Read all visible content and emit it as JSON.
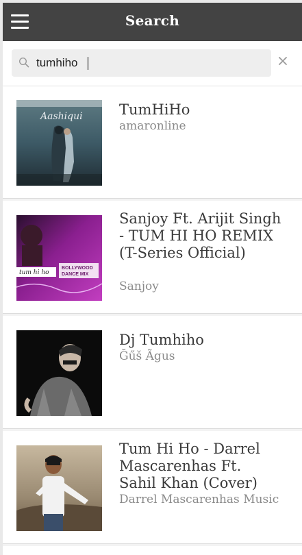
{
  "header": {
    "title": "Search",
    "menu_icon": "hamburger-menu-icon"
  },
  "search": {
    "value": "tumhiho",
    "search_icon": "search-icon",
    "clear_icon": "close-icon"
  },
  "results": [
    {
      "title": "TumHiHo",
      "artist": "amaronline",
      "thumbnail": "aashiqui-2-poster"
    },
    {
      "title": "Sanjoy Ft. Arijit Singh - TUM HI HO REMIX (T-Series Official)",
      "artist": "Sanjoy",
      "thumbnail": "bollywood-dance-mix-cover"
    },
    {
      "title": "Dj Tumhiho",
      "artist": "Ğűš Ãgus",
      "thumbnail": "dj-portrait-photo"
    },
    {
      "title": "Tum Hi Ho - Darrel Mascarenhas Ft. Sahil Khan (Cover)",
      "artist": "Darrel Mascarenhas Music",
      "thumbnail": "outdoor-portrait-photo"
    }
  ]
}
